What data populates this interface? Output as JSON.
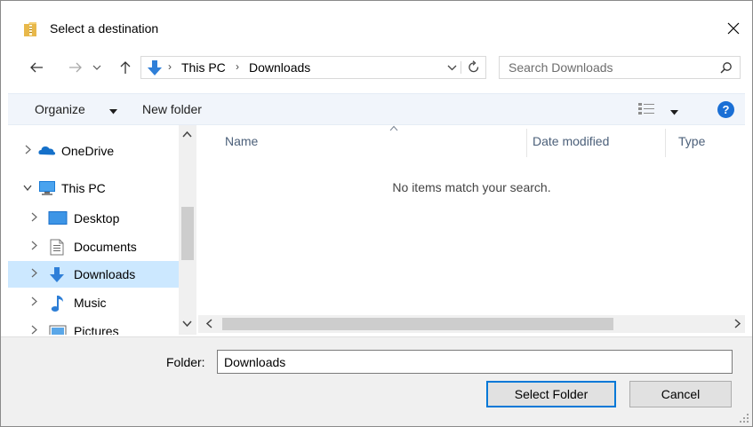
{
  "window": {
    "title": "Select a destination",
    "close_glyph": "✕"
  },
  "navigation": {
    "back_glyph": "←",
    "forward_glyph": "→",
    "recent_glyph": "⌄",
    "up_glyph": "↑"
  },
  "address_bar": {
    "breadcrumbs": [
      "This PC",
      "Downloads"
    ],
    "separator": "›",
    "dropdown_glyph": "⌄",
    "refresh_glyph": "↻"
  },
  "search": {
    "placeholder": "Search Downloads"
  },
  "command_bar": {
    "organize_label": "Organize",
    "new_folder_label": "New folder",
    "help_label": "?"
  },
  "nav_pane": {
    "items": [
      {
        "label": "OneDrive",
        "icon": "cloud-icon",
        "level": 0
      },
      {
        "label": "This PC",
        "icon": "computer-icon",
        "level": 0,
        "expanded": true
      },
      {
        "label": "Desktop",
        "icon": "desktop-icon",
        "level": 1
      },
      {
        "label": "Documents",
        "icon": "documents-icon",
        "level": 1
      },
      {
        "label": "Downloads",
        "icon": "download-arrow-icon",
        "level": 1,
        "selected": true
      },
      {
        "label": "Music",
        "icon": "music-note-icon",
        "level": 1
      },
      {
        "label": "Pictures",
        "icon": "pictures-icon",
        "level": 1
      }
    ]
  },
  "file_list": {
    "columns": [
      "Name",
      "Date modified",
      "Type"
    ],
    "empty_message": "No items match your search."
  },
  "footer": {
    "folder_label": "Folder:",
    "folder_value": "Downloads",
    "select_button": "Select Folder",
    "cancel_button": "Cancel"
  },
  "colors": {
    "accent": "#0078d7",
    "selection": "#cce8ff",
    "command_bar": "#f1f5fb",
    "footer": "#f0f0f0",
    "help": "#1a6fd5"
  }
}
